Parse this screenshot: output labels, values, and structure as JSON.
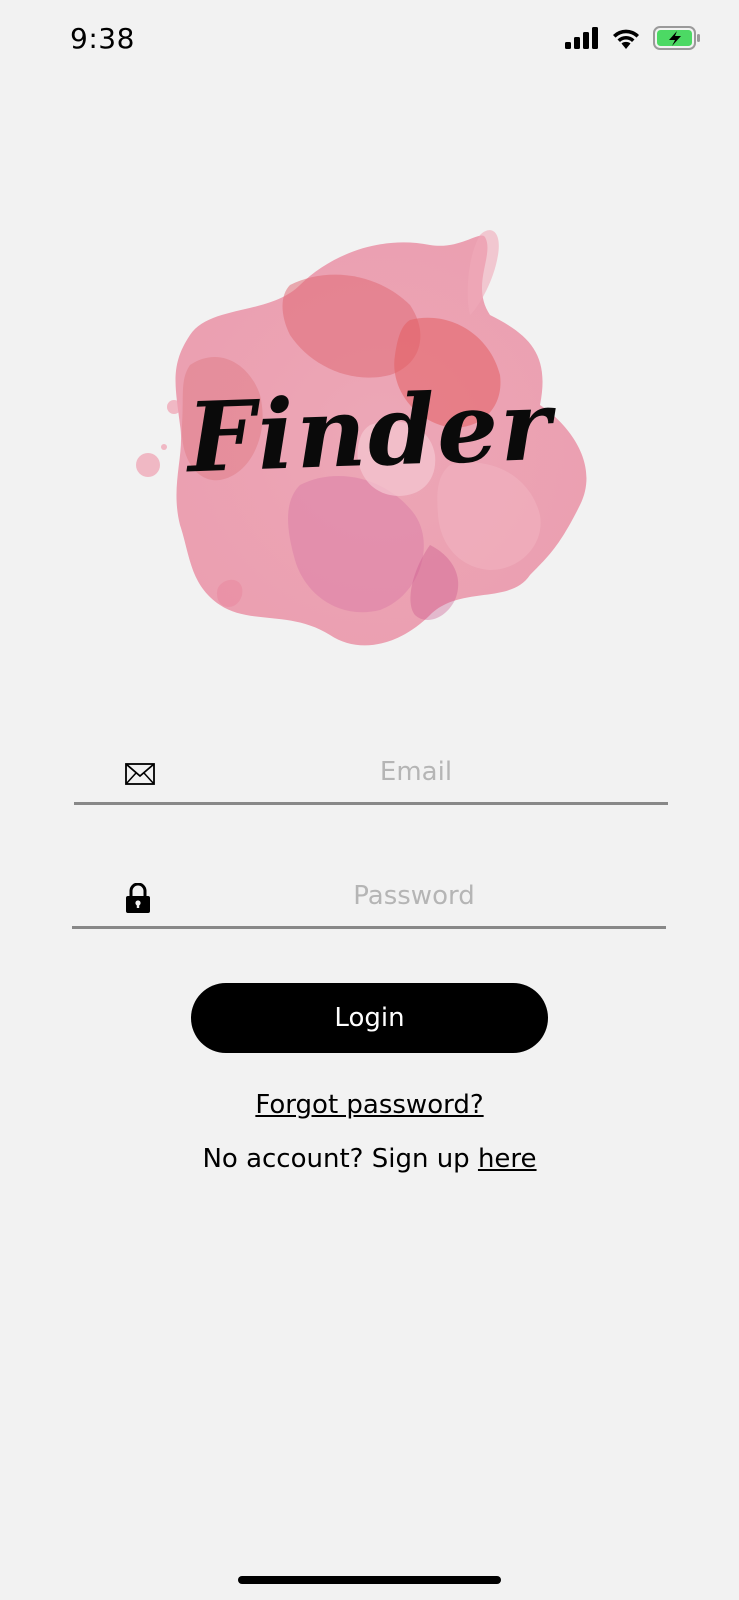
{
  "status_bar": {
    "time": "9:38",
    "icons": [
      "cellular-signal-icon",
      "wifi-icon",
      "battery-charging-icon"
    ],
    "battery_color": "#4cd964"
  },
  "logo": {
    "text": "Finder",
    "splash_colors": [
      "#e8899a",
      "#e06c76",
      "#f0aab9",
      "#d977a4"
    ]
  },
  "form": {
    "email": {
      "placeholder": "Email",
      "value": "",
      "icon": "envelope-icon"
    },
    "password": {
      "placeholder": "Password",
      "value": "",
      "icon": "lock-icon"
    },
    "login_label": "Login",
    "forgot_label": "Forgot password?",
    "signup_prefix": "No account? Sign up ",
    "signup_link": "here"
  },
  "colors": {
    "background": "#f2f2f2",
    "button": "#000000",
    "button_text": "#ffffff",
    "placeholder": "#b5b5b5",
    "underline": "#888888"
  }
}
